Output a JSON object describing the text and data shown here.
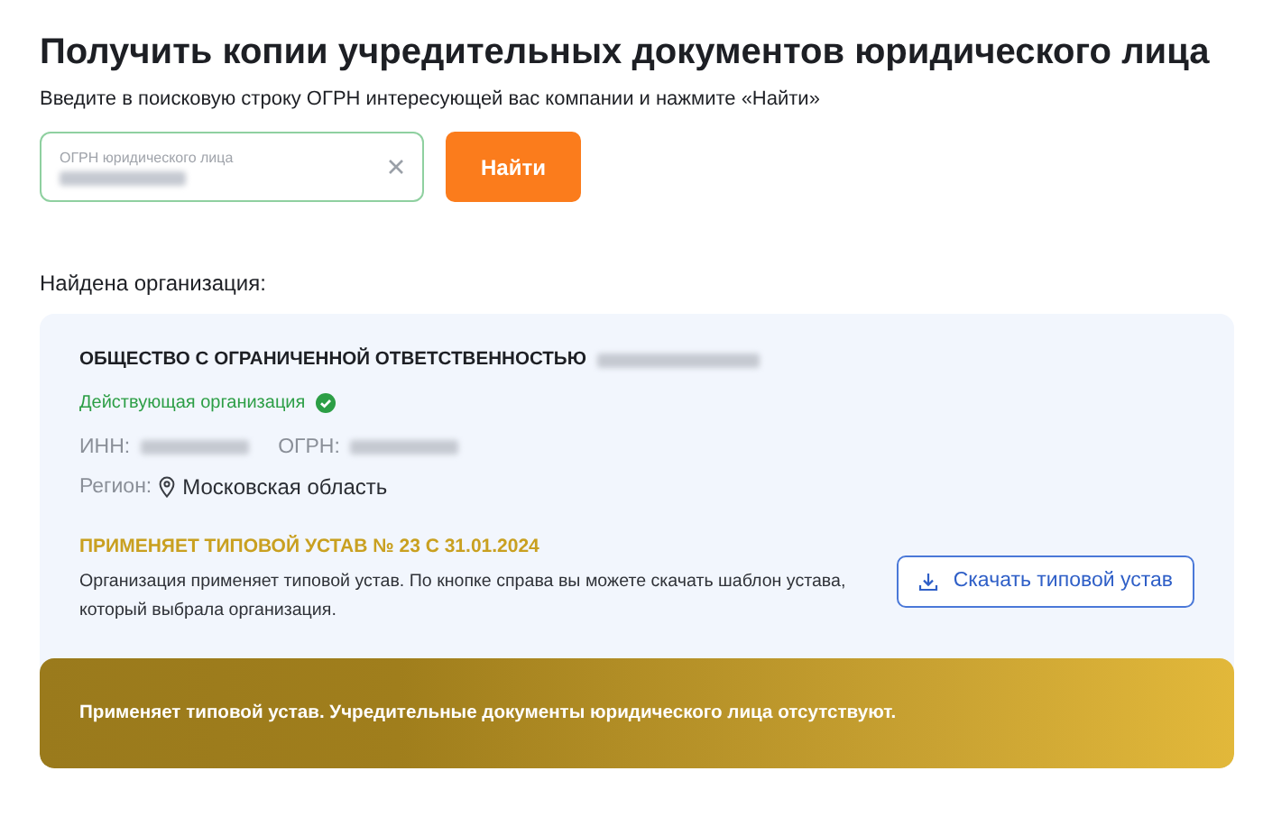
{
  "title": "Получить копии учредительных документов юридического лица",
  "subtitle": "Введите в поисковую строку ОГРН интересующей вас компании и нажмите «Найти»",
  "search": {
    "label": "ОГРН юридического лица",
    "value_hidden": true
  },
  "search_button": "Найти",
  "found_label": "Найдена организация:",
  "organization": {
    "name": "ОБЩЕСТВО С ОГРАНИЧЕННОЙ ОТВЕТСТВЕННОСТЬЮ",
    "name_hidden": true,
    "status": "Действующая организация",
    "active": true,
    "fields": [
      {
        "label": "ИНН:",
        "value_hidden": true
      },
      {
        "label": "ОГРН:",
        "value_hidden": true
      }
    ],
    "region_label": "Регион:",
    "region": "Московская область"
  },
  "charter": {
    "heading": "ПРИМЕНЯЕТ ТИПОВОЙ УСТАВ № 23 С 31.01.2024",
    "text": "Организация применяет типовой устав. По кнопке справа вы можете скачать шаблон устава, который выбрала организация.",
    "button": "Скачать типовой устав"
  },
  "banner": "Применяет типовой устав. Учредительные документы юридического лица отсутствуют."
}
